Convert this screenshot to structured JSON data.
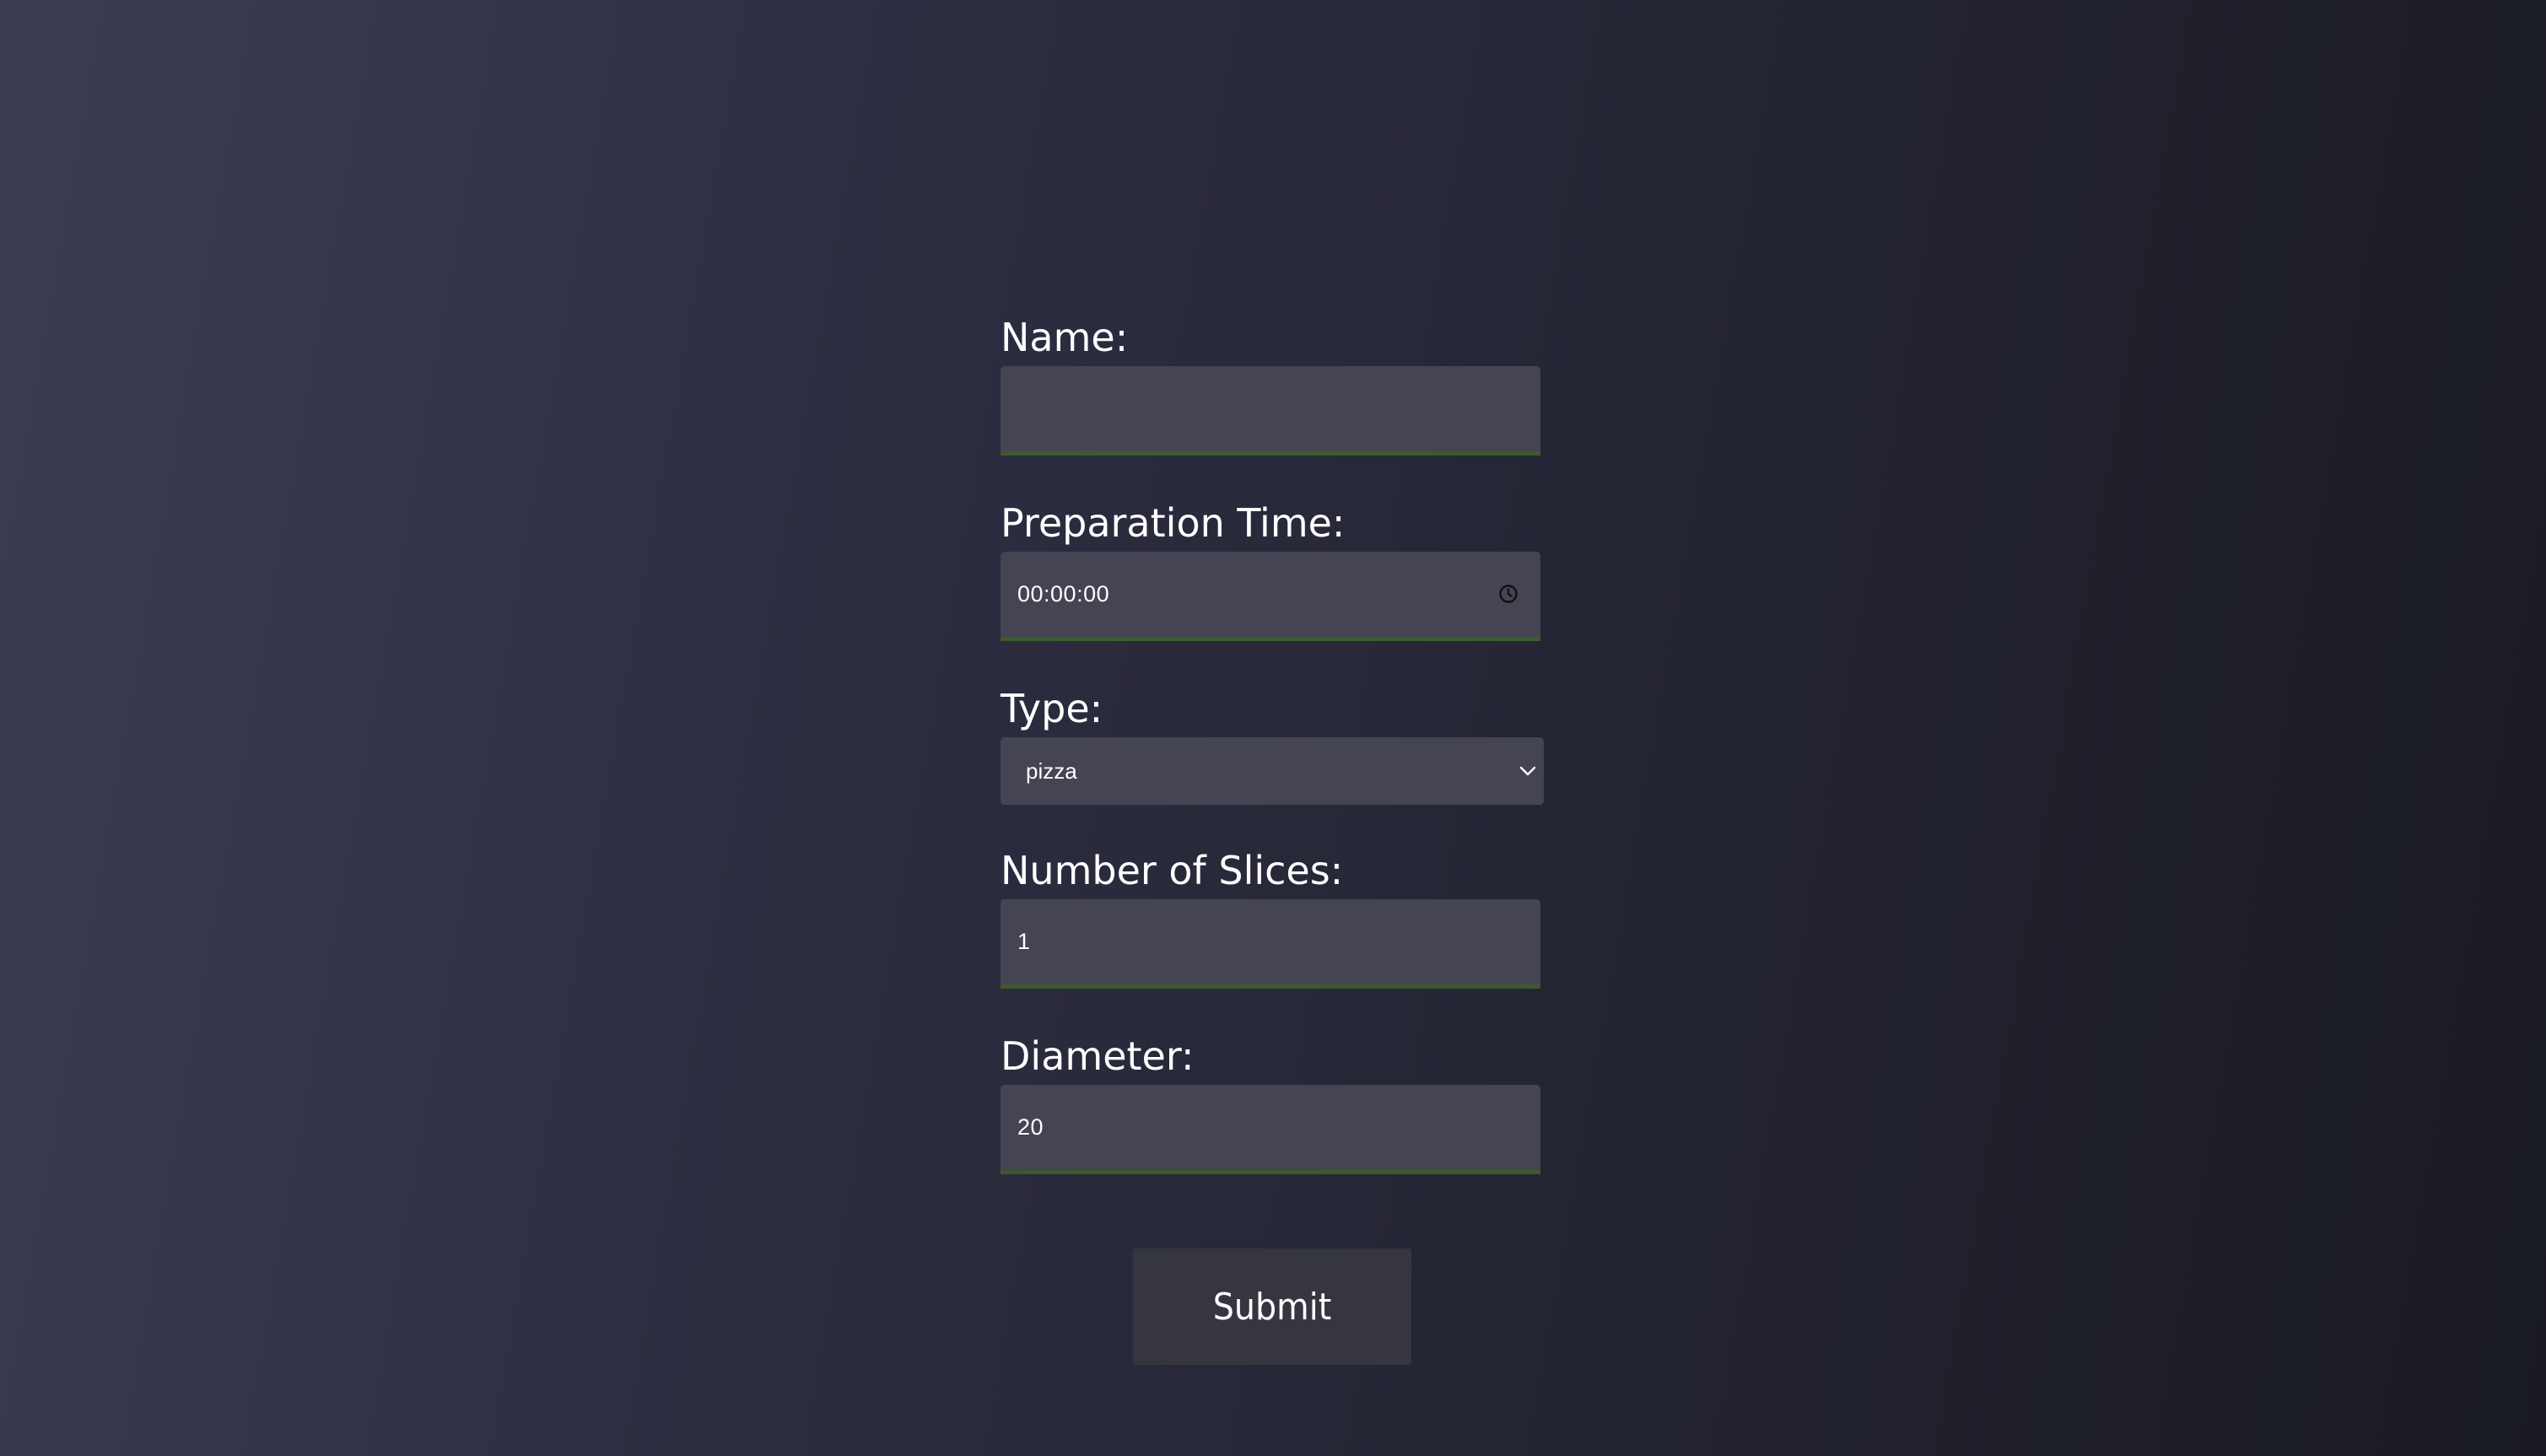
{
  "form": {
    "name": {
      "label": "Name:",
      "value": ""
    },
    "prep_time": {
      "label": "Preparation Time:",
      "value": "00:00:00",
      "icon": "clock-icon"
    },
    "type": {
      "label": "Type:",
      "selected": "pizza",
      "icon": "chevron-down-icon"
    },
    "slices": {
      "label": "Number of Slices:",
      "value": "1"
    },
    "diameter": {
      "label": "Diameter:",
      "value": "20"
    },
    "submit_label": "Submit"
  },
  "colors": {
    "field_bg": "#454452",
    "field_underline": "#3c5a2a",
    "button_bg": "#363641",
    "text": "#ffffff"
  }
}
